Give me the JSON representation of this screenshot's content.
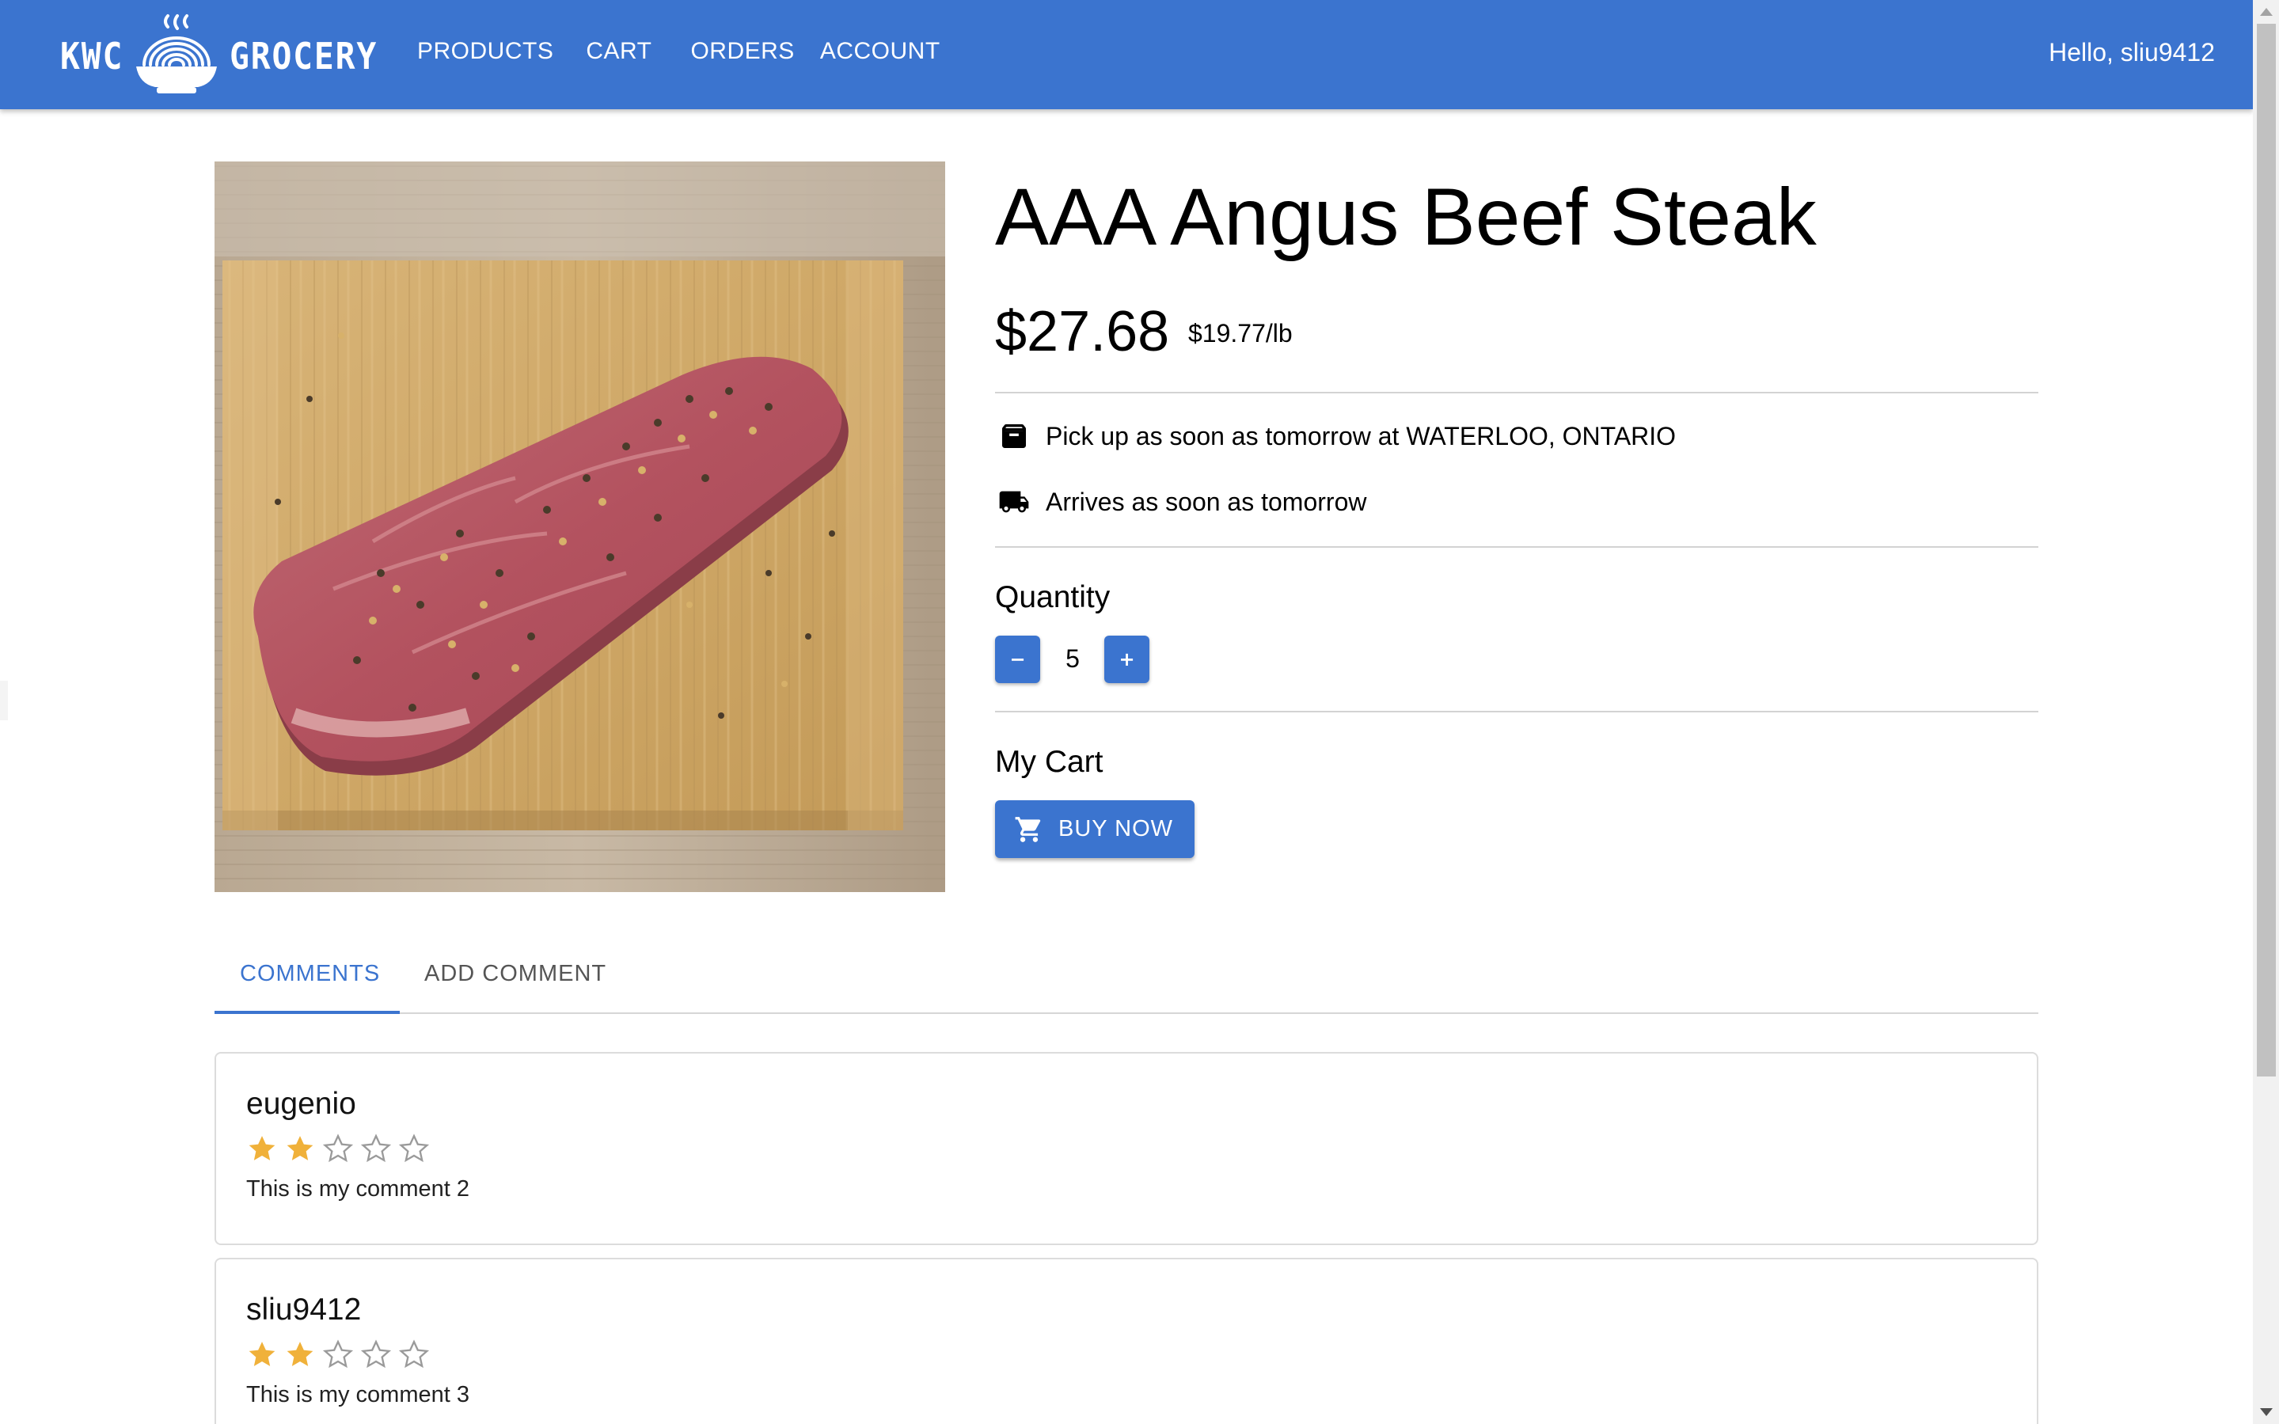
{
  "app": {
    "brand_left": "KWC",
    "brand_right": "GROCERY",
    "accent_color": "#3b74cf",
    "nav": {
      "products": "PRODUCTS",
      "cart": "CART",
      "orders": "ORDERS",
      "account": "ACCOUNT"
    },
    "greeting": "Hello, sliu9412"
  },
  "product": {
    "title": "AAA Angus Beef Steak",
    "price": "$27.68",
    "unit_price": "$19.77/lb",
    "pickup_icon": "archive-box-icon",
    "pickup_text": "Pick up as soon as tomorrow at WATERLOO, ONTARIO",
    "delivery_icon": "truck-icon",
    "delivery_text": "Arrives as soon as tomorrow",
    "quantity_label": "Quantity",
    "quantity_minus": "−",
    "quantity_value": "5",
    "quantity_plus": "+",
    "cart_label": "My Cart",
    "buy_icon": "shopping-cart-icon",
    "buy_label": "BUY NOW"
  },
  "tabs": {
    "comments": "COMMENTS",
    "add_comment": "ADD COMMENT",
    "active": "COMMENTS"
  },
  "comments": [
    {
      "user": "eugenio",
      "rating": 2,
      "max_rating": 5,
      "text": "This is my comment 2"
    },
    {
      "user": "sliu9412",
      "rating": 2,
      "max_rating": 5,
      "text": "This is my comment 3"
    }
  ],
  "star_color": "#f0b13a"
}
